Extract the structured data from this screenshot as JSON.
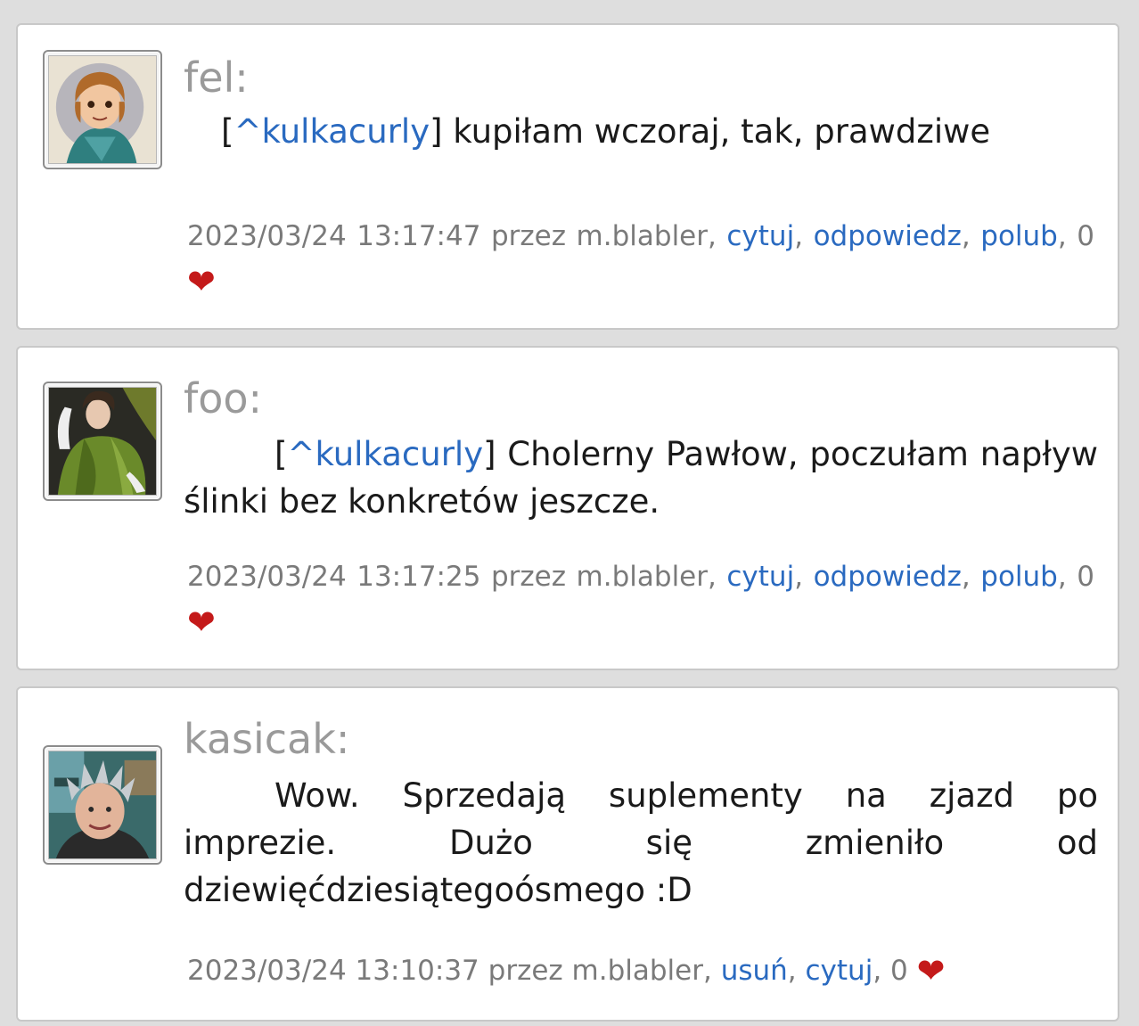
{
  "posts": [
    {
      "author": "fel:",
      "mention": "^kulkacurly",
      "text": "kupiłam wczoraj, tak, prawdziwe",
      "datetime": "2023/03/24",
      "time": "13:17:47",
      "byline": "przez m.blabler,",
      "actions": [
        "cytuj",
        "odpowiedz",
        "polub"
      ],
      "likes": "0",
      "heart_icon": "heart-icon"
    },
    {
      "author": "foo:",
      "mention": "^kulkacurly",
      "text": "Cholerny Pawłow, poczułam napływ ślinki bez konkretów jeszcze.",
      "datetime": "2023/03/24",
      "time": "13:17:25",
      "byline": "przez m.blabler,",
      "actions": [
        "cytuj",
        "odpowiedz",
        "polub"
      ],
      "likes": "0",
      "heart_icon": "heart-icon"
    },
    {
      "author": "kasicak:",
      "text": "Wow. Sprzedają suplementy na zjazd po imprezie. Dużo się zmieniło od dziewięćdziesiątegoósmego :D",
      "datetime": "2023/03/24",
      "time": "13:10:37",
      "byline": "przez m.blabler,",
      "actions": [
        "usuń",
        "cytuj"
      ],
      "likes": "0",
      "heart_icon": "heart-icon"
    }
  ],
  "colors": {
    "link": "#2a6ac0",
    "author": "#9a9a9a",
    "meta": "#7a7a7a",
    "heart": "#c41a1a",
    "background": "#dedede"
  }
}
